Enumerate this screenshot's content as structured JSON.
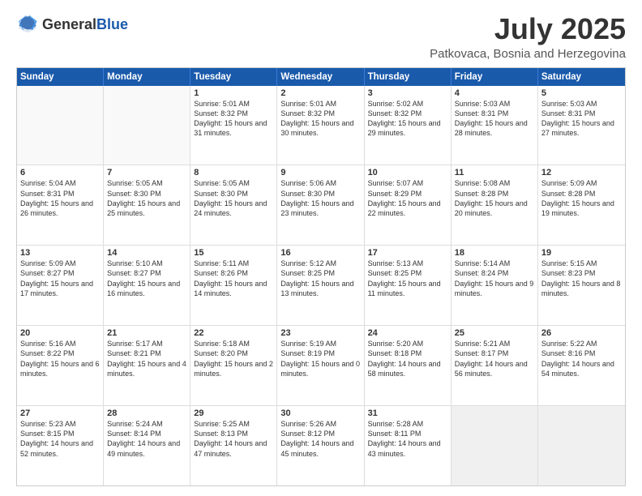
{
  "logo": {
    "general": "General",
    "blue": "Blue"
  },
  "header": {
    "month": "July 2025",
    "location": "Patkovaca, Bosnia and Herzegovina"
  },
  "weekdays": [
    "Sunday",
    "Monday",
    "Tuesday",
    "Wednesday",
    "Thursday",
    "Friday",
    "Saturday"
  ],
  "weeks": [
    [
      {
        "day": "",
        "text": "",
        "empty": true
      },
      {
        "day": "",
        "text": "",
        "empty": true
      },
      {
        "day": "1",
        "text": "Sunrise: 5:01 AM\nSunset: 8:32 PM\nDaylight: 15 hours and 31 minutes."
      },
      {
        "day": "2",
        "text": "Sunrise: 5:01 AM\nSunset: 8:32 PM\nDaylight: 15 hours and 30 minutes."
      },
      {
        "day": "3",
        "text": "Sunrise: 5:02 AM\nSunset: 8:32 PM\nDaylight: 15 hours and 29 minutes."
      },
      {
        "day": "4",
        "text": "Sunrise: 5:03 AM\nSunset: 8:31 PM\nDaylight: 15 hours and 28 minutes."
      },
      {
        "day": "5",
        "text": "Sunrise: 5:03 AM\nSunset: 8:31 PM\nDaylight: 15 hours and 27 minutes."
      }
    ],
    [
      {
        "day": "6",
        "text": "Sunrise: 5:04 AM\nSunset: 8:31 PM\nDaylight: 15 hours and 26 minutes."
      },
      {
        "day": "7",
        "text": "Sunrise: 5:05 AM\nSunset: 8:30 PM\nDaylight: 15 hours and 25 minutes."
      },
      {
        "day": "8",
        "text": "Sunrise: 5:05 AM\nSunset: 8:30 PM\nDaylight: 15 hours and 24 minutes."
      },
      {
        "day": "9",
        "text": "Sunrise: 5:06 AM\nSunset: 8:30 PM\nDaylight: 15 hours and 23 minutes."
      },
      {
        "day": "10",
        "text": "Sunrise: 5:07 AM\nSunset: 8:29 PM\nDaylight: 15 hours and 22 minutes."
      },
      {
        "day": "11",
        "text": "Sunrise: 5:08 AM\nSunset: 8:28 PM\nDaylight: 15 hours and 20 minutes."
      },
      {
        "day": "12",
        "text": "Sunrise: 5:09 AM\nSunset: 8:28 PM\nDaylight: 15 hours and 19 minutes."
      }
    ],
    [
      {
        "day": "13",
        "text": "Sunrise: 5:09 AM\nSunset: 8:27 PM\nDaylight: 15 hours and 17 minutes."
      },
      {
        "day": "14",
        "text": "Sunrise: 5:10 AM\nSunset: 8:27 PM\nDaylight: 15 hours and 16 minutes."
      },
      {
        "day": "15",
        "text": "Sunrise: 5:11 AM\nSunset: 8:26 PM\nDaylight: 15 hours and 14 minutes."
      },
      {
        "day": "16",
        "text": "Sunrise: 5:12 AM\nSunset: 8:25 PM\nDaylight: 15 hours and 13 minutes."
      },
      {
        "day": "17",
        "text": "Sunrise: 5:13 AM\nSunset: 8:25 PM\nDaylight: 15 hours and 11 minutes."
      },
      {
        "day": "18",
        "text": "Sunrise: 5:14 AM\nSunset: 8:24 PM\nDaylight: 15 hours and 9 minutes."
      },
      {
        "day": "19",
        "text": "Sunrise: 5:15 AM\nSunset: 8:23 PM\nDaylight: 15 hours and 8 minutes."
      }
    ],
    [
      {
        "day": "20",
        "text": "Sunrise: 5:16 AM\nSunset: 8:22 PM\nDaylight: 15 hours and 6 minutes."
      },
      {
        "day": "21",
        "text": "Sunrise: 5:17 AM\nSunset: 8:21 PM\nDaylight: 15 hours and 4 minutes."
      },
      {
        "day": "22",
        "text": "Sunrise: 5:18 AM\nSunset: 8:20 PM\nDaylight: 15 hours and 2 minutes."
      },
      {
        "day": "23",
        "text": "Sunrise: 5:19 AM\nSunset: 8:19 PM\nDaylight: 15 hours and 0 minutes."
      },
      {
        "day": "24",
        "text": "Sunrise: 5:20 AM\nSunset: 8:18 PM\nDaylight: 14 hours and 58 minutes."
      },
      {
        "day": "25",
        "text": "Sunrise: 5:21 AM\nSunset: 8:17 PM\nDaylight: 14 hours and 56 minutes."
      },
      {
        "day": "26",
        "text": "Sunrise: 5:22 AM\nSunset: 8:16 PM\nDaylight: 14 hours and 54 minutes."
      }
    ],
    [
      {
        "day": "27",
        "text": "Sunrise: 5:23 AM\nSunset: 8:15 PM\nDaylight: 14 hours and 52 minutes."
      },
      {
        "day": "28",
        "text": "Sunrise: 5:24 AM\nSunset: 8:14 PM\nDaylight: 14 hours and 49 minutes."
      },
      {
        "day": "29",
        "text": "Sunrise: 5:25 AM\nSunset: 8:13 PM\nDaylight: 14 hours and 47 minutes."
      },
      {
        "day": "30",
        "text": "Sunrise: 5:26 AM\nSunset: 8:12 PM\nDaylight: 14 hours and 45 minutes."
      },
      {
        "day": "31",
        "text": "Sunrise: 5:28 AM\nSunset: 8:11 PM\nDaylight: 14 hours and 43 minutes."
      },
      {
        "day": "",
        "text": "",
        "empty": true,
        "shaded": true
      },
      {
        "day": "",
        "text": "",
        "empty": true,
        "shaded": true
      }
    ]
  ]
}
